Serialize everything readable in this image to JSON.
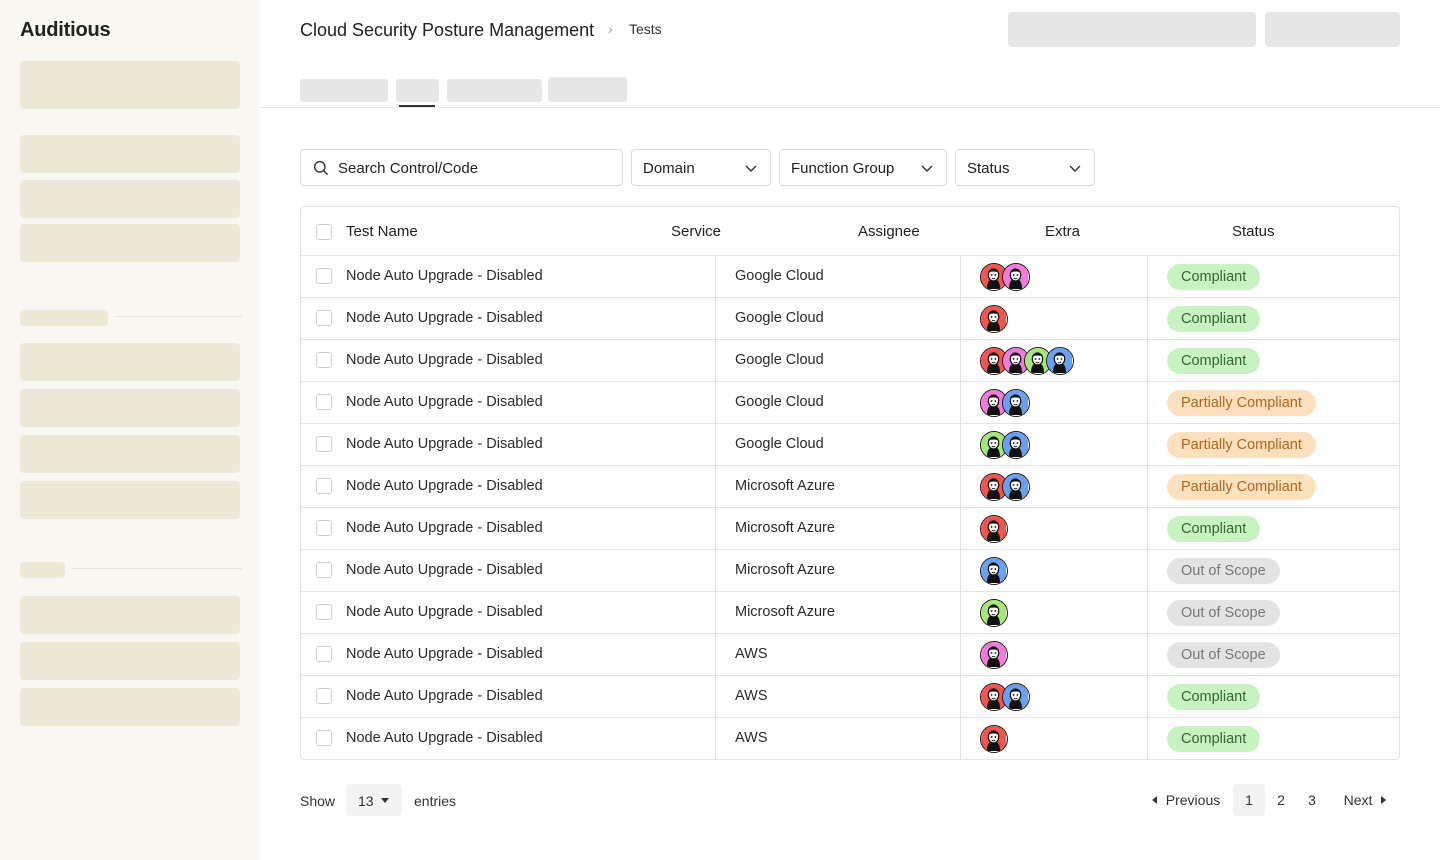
{
  "sidebar": {
    "brand": "Auditious"
  },
  "header": {
    "breadcrumb_title": "Cloud Security Posture Management",
    "breadcrumb_separator": "›",
    "breadcrumb_current": "Tests"
  },
  "filters": {
    "search_placeholder": "Search Control/Code",
    "domain_label": "Domain",
    "function_group_label": "Function Group",
    "status_label": "Status"
  },
  "table": {
    "columns": [
      "Test Name",
      "Service",
      "Assignee",
      "Extra",
      "Status"
    ],
    "rows": [
      {
        "name": "Node Auto Upgrade - Disabled",
        "service": "Google Cloud",
        "avatars": [
          "red",
          "pink"
        ],
        "status": "Compliant"
      },
      {
        "name": "Node Auto Upgrade - Disabled",
        "service": "Google Cloud",
        "avatars": [
          "red"
        ],
        "status": "Compliant"
      },
      {
        "name": "Node Auto Upgrade - Disabled",
        "service": "Google Cloud",
        "avatars": [
          "red",
          "pink",
          "green",
          "blue"
        ],
        "status": "Compliant"
      },
      {
        "name": "Node Auto Upgrade - Disabled",
        "service": "Google Cloud",
        "avatars": [
          "pink",
          "blue"
        ],
        "status": "Partially Compliant"
      },
      {
        "name": "Node Auto Upgrade - Disabled",
        "service": "Google Cloud",
        "avatars": [
          "green",
          "blue"
        ],
        "status": "Partially Compliant"
      },
      {
        "name": "Node Auto Upgrade - Disabled",
        "service": "Microsoft Azure",
        "avatars": [
          "red",
          "blue"
        ],
        "status": "Partially Compliant"
      },
      {
        "name": "Node Auto Upgrade - Disabled",
        "service": "Microsoft Azure",
        "avatars": [
          "red"
        ],
        "status": "Compliant"
      },
      {
        "name": "Node Auto Upgrade - Disabled",
        "service": "Microsoft Azure",
        "avatars": [
          "blue"
        ],
        "status": "Out of Scope"
      },
      {
        "name": "Node Auto Upgrade - Disabled",
        "service": "Microsoft Azure",
        "avatars": [
          "green"
        ],
        "status": "Out of Scope"
      },
      {
        "name": "Node Auto Upgrade - Disabled",
        "service": "AWS",
        "avatars": [
          "pink"
        ],
        "status": "Out of Scope"
      },
      {
        "name": "Node Auto Upgrade - Disabled",
        "service": "AWS",
        "avatars": [
          "red",
          "blue"
        ],
        "status": "Compliant"
      },
      {
        "name": "Node Auto Upgrade - Disabled",
        "service": "AWS",
        "avatars": [
          "red"
        ],
        "status": "Compliant"
      }
    ]
  },
  "status_styles": {
    "Compliant": {
      "bg": "#c9f2c2",
      "fg": "#2f6b2a"
    },
    "Partially Compliant": {
      "bg": "#fde0bd",
      "fg": "#b5651d"
    },
    "Out of Scope": {
      "bg": "#e3e3e3",
      "fg": "#777777"
    }
  },
  "avatar_colors": {
    "red": "#f0554f",
    "pink": "#f27ad9",
    "green": "#a6e77a",
    "blue": "#6b9ff0"
  },
  "footer": {
    "show_label": "Show",
    "entries_value": "13",
    "entries_label": "entries",
    "prev_label": "Previous",
    "pages": [
      "1",
      "2",
      "3"
    ],
    "next_label": "Next"
  }
}
